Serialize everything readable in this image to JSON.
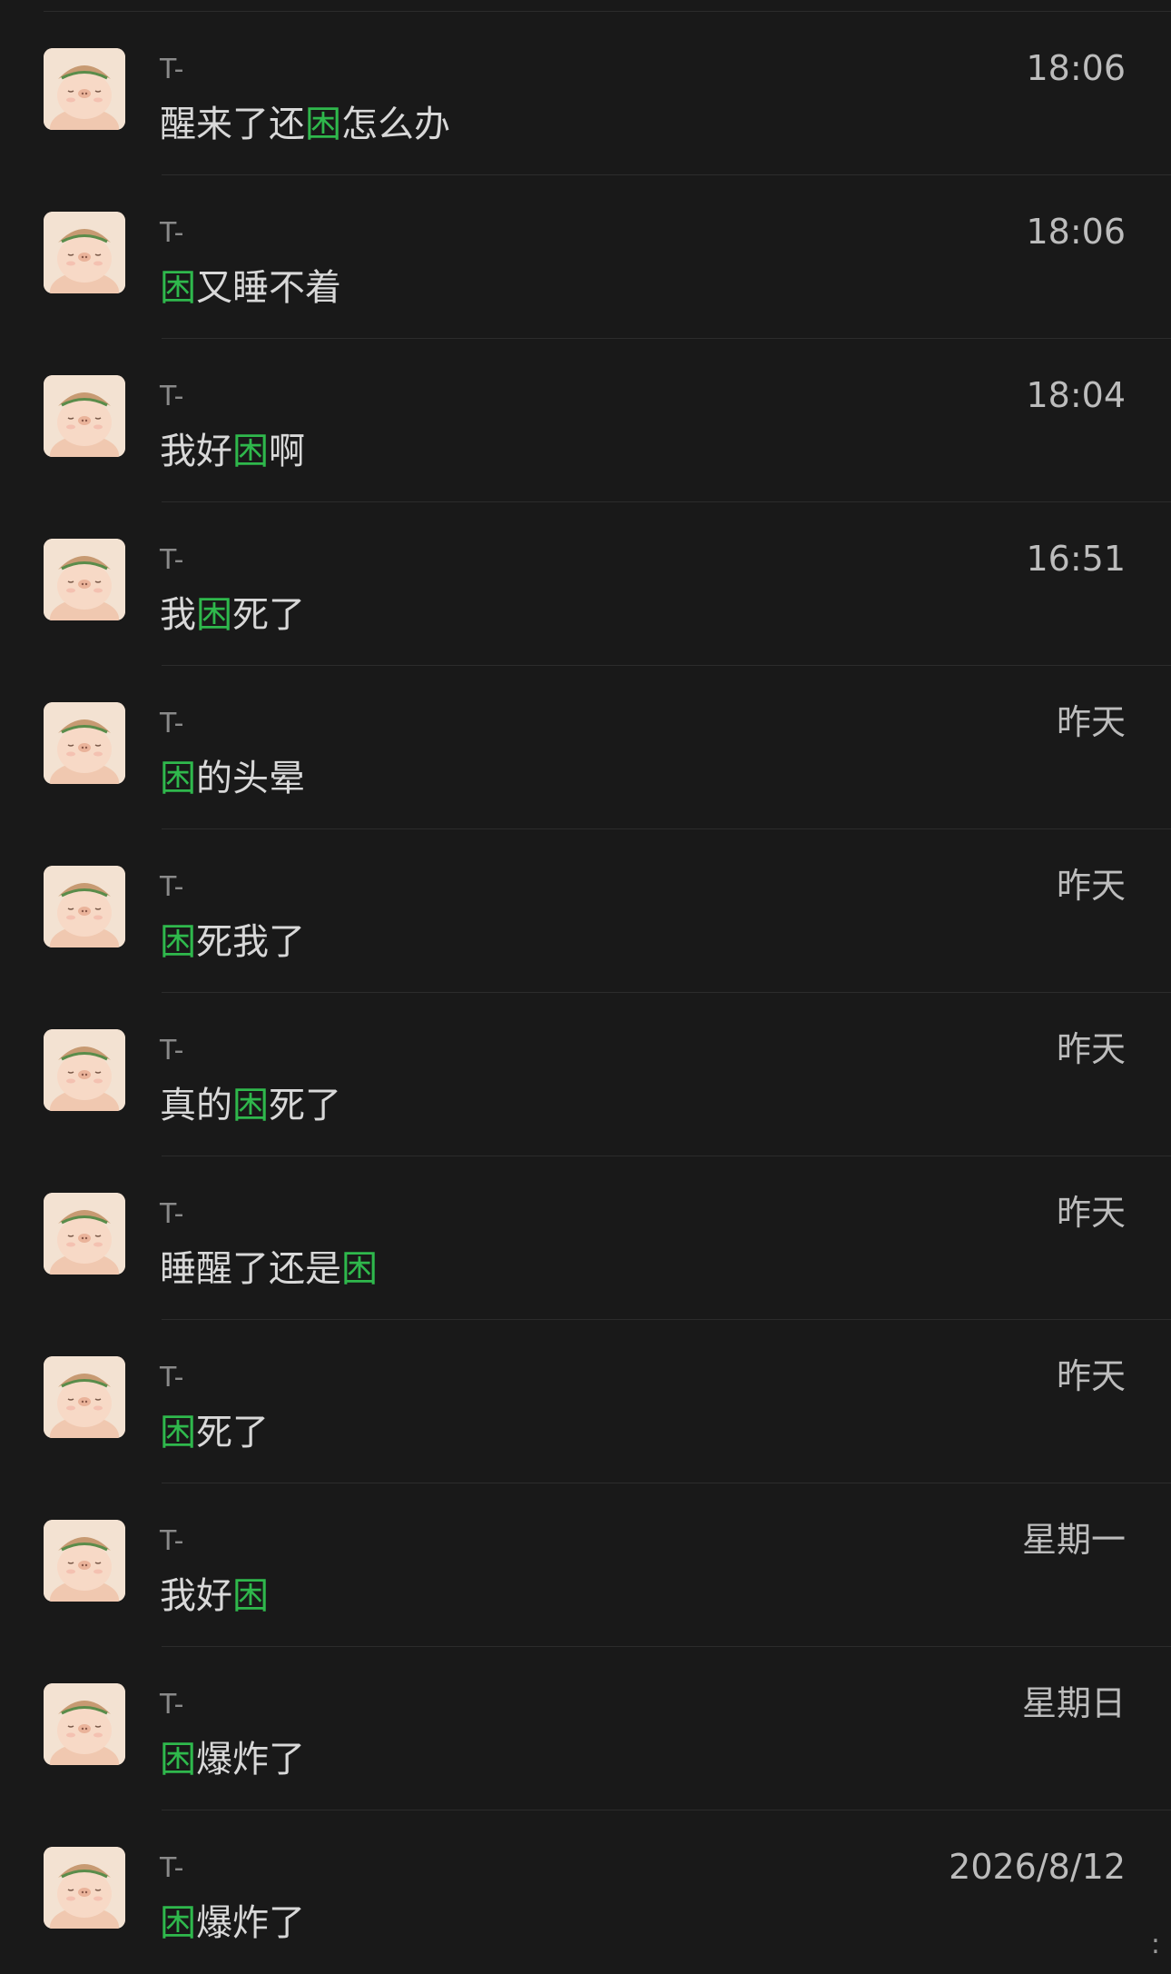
{
  "colors": {
    "background": "#191919",
    "divider": "#2c2c2c",
    "highlight": "#2fb84c",
    "message_text": "#d8d8d8",
    "sender_text": "#8a8a8a",
    "time_text": "#bcbcbc"
  },
  "avatar_icon": "pig-sticker-avatar",
  "results": [
    {
      "sender": "T-",
      "time": "18:06",
      "message": [
        {
          "t": "醒来了还",
          "hl": false
        },
        {
          "t": "困",
          "hl": true
        },
        {
          "t": "怎么办",
          "hl": false
        }
      ]
    },
    {
      "sender": "T-",
      "time": "18:06",
      "message": [
        {
          "t": "困",
          "hl": true
        },
        {
          "t": "又睡不着",
          "hl": false
        }
      ]
    },
    {
      "sender": "T-",
      "time": "18:04",
      "message": [
        {
          "t": "我好",
          "hl": false
        },
        {
          "t": "困",
          "hl": true
        },
        {
          "t": "啊",
          "hl": false
        }
      ]
    },
    {
      "sender": "T-",
      "time": "16:51",
      "message": [
        {
          "t": "我",
          "hl": false
        },
        {
          "t": "困",
          "hl": true
        },
        {
          "t": "死了",
          "hl": false
        }
      ]
    },
    {
      "sender": "T-",
      "time": "昨天",
      "message": [
        {
          "t": "困",
          "hl": true
        },
        {
          "t": "的头晕",
          "hl": false
        }
      ]
    },
    {
      "sender": "T-",
      "time": "昨天",
      "message": [
        {
          "t": "困",
          "hl": true
        },
        {
          "t": "死我了",
          "hl": false
        }
      ]
    },
    {
      "sender": "T-",
      "time": "昨天",
      "message": [
        {
          "t": "真的",
          "hl": false
        },
        {
          "t": "困",
          "hl": true
        },
        {
          "t": "死了",
          "hl": false
        }
      ]
    },
    {
      "sender": "T-",
      "time": "昨天",
      "message": [
        {
          "t": "睡醒了还是",
          "hl": false
        },
        {
          "t": "困",
          "hl": true
        }
      ]
    },
    {
      "sender": "T-",
      "time": "昨天",
      "message": [
        {
          "t": "困",
          "hl": true
        },
        {
          "t": "死了",
          "hl": false
        }
      ]
    },
    {
      "sender": "T-",
      "time": "星期一",
      "message": [
        {
          "t": "我好",
          "hl": false
        },
        {
          "t": "困",
          "hl": true
        }
      ]
    },
    {
      "sender": "T-",
      "time": "星期日",
      "message": [
        {
          "t": "困",
          "hl": true
        },
        {
          "t": "爆炸了",
          "hl": false
        }
      ]
    },
    {
      "sender": "T-",
      "time": "2026/8/12",
      "message": [
        {
          "t": "困",
          "hl": true
        },
        {
          "t": "爆炸了",
          "hl": false
        }
      ]
    }
  ],
  "corner_glyph": ":"
}
